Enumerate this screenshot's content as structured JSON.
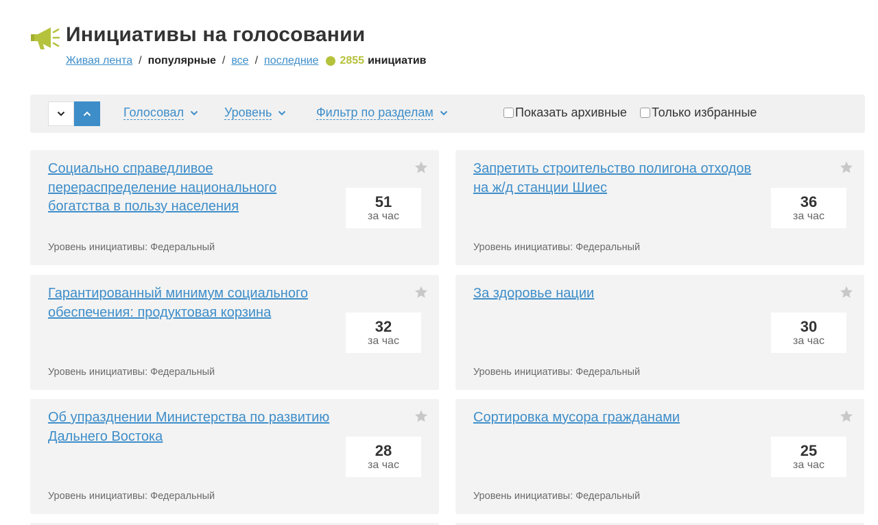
{
  "header": {
    "title": "Инициативы на голосовании",
    "icon": "megaphone-icon",
    "accent_color": "#b5c23c"
  },
  "subnav": {
    "live_feed": "Живая лента",
    "popular": "популярные",
    "all": "все",
    "recent": "последние",
    "separator": "/",
    "count": "2855",
    "count_word": "инициатив"
  },
  "filters": {
    "sort_desc_icon": "chevron-down-icon",
    "sort_asc_icon": "chevron-up-icon",
    "voted": "Голосовал",
    "level": "Уровень",
    "section_filter": "Фильтр по разделам",
    "show_archived": "Показать архивные",
    "only_favorites": "Только избранные"
  },
  "colors": {
    "link": "#3d8dc9",
    "card_bg": "#f3f3f3"
  },
  "initiatives": [
    {
      "title": "Социально справедливое перераспределение национального богатства в пользу населения",
      "count": "51",
      "unit": "за час",
      "level": "Уровень инициативы: Федеральный"
    },
    {
      "title": "Запретить строительство полигона отходов на ж/д станции Шиес",
      "count": "36",
      "unit": "за час",
      "level": "Уровень инициативы: Федеральный"
    },
    {
      "title": "Гарантированный минимум социального обеспечения: продуктовая корзина",
      "count": "32",
      "unit": "за час",
      "level": "Уровень инициативы: Федеральный"
    },
    {
      "title": "За здоровье нации",
      "count": "30",
      "unit": "за час",
      "level": "Уровень инициативы: Федеральный"
    },
    {
      "title": "Об упразднении Министерства по развитию Дальнего Востока",
      "count": "28",
      "unit": "за час",
      "level": "Уровень инициативы: Федеральный"
    },
    {
      "title": "Сортировка мусора гражданами",
      "count": "25",
      "unit": "за час",
      "level": "Уровень инициативы: Федеральный"
    }
  ]
}
